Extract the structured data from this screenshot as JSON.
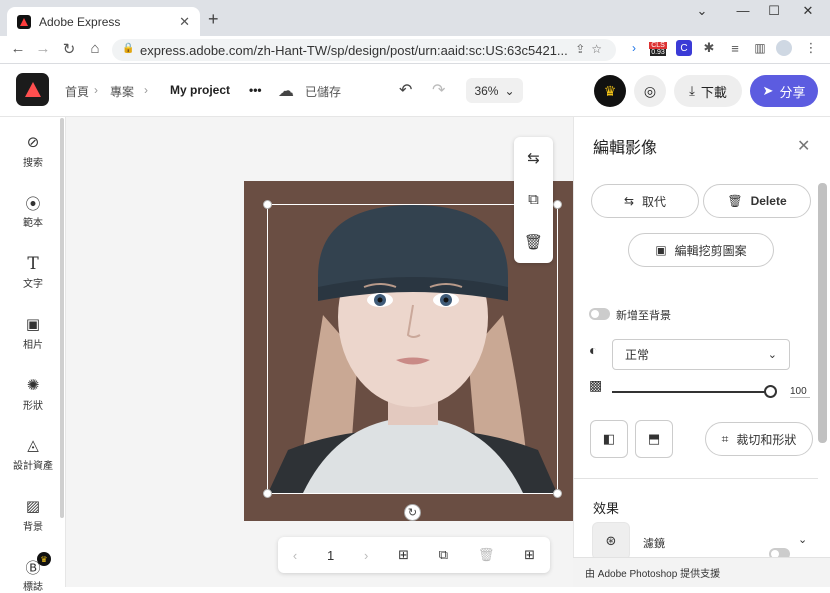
{
  "browser": {
    "tab_title": "Adobe Express",
    "tab_close": "✕",
    "new_tab": "+",
    "url": "express.adobe.com/zh-Hant-TW/sp/design/post/urn:aaid:sc:US:63c5421...",
    "window_min": "—",
    "window_max": "☐",
    "window_close": "✕",
    "ext_badge": "0.93"
  },
  "header": {
    "breadcrumb_home": "首頁",
    "breadcrumb_projects": "專案",
    "project_name": "My project",
    "more": "•••",
    "save_status": "已儲存",
    "zoom": "36%",
    "download_label": "下載",
    "share_label": "分享"
  },
  "sidebar": {
    "items": [
      {
        "label": "搜索",
        "icon": "search-icon"
      },
      {
        "label": "範本",
        "icon": "templates-icon"
      },
      {
        "label": "文字",
        "icon": "text-icon"
      },
      {
        "label": "相片",
        "icon": "photo-icon"
      },
      {
        "label": "形狀",
        "icon": "shapes-icon"
      },
      {
        "label": "設計資產",
        "icon": "design-assets-icon"
      },
      {
        "label": "背景",
        "icon": "background-icon"
      },
      {
        "label": "標誌",
        "icon": "brand-icon"
      }
    ]
  },
  "pager": {
    "page_number": "1"
  },
  "panel": {
    "title": "編輯影像",
    "replace_label": "取代",
    "delete_label": "Delete",
    "cutout_label": "編輯挖剪圖案",
    "add_to_background_label": "新增至背景",
    "blend_mode": "正常",
    "opacity_value": "100",
    "crop_label": "裁切和形狀",
    "effects_heading": "效果",
    "filters_label": "濾鏡",
    "footer_text": "由 Adobe Photoshop 提供支援"
  },
  "colors": {
    "accent": "#5c5ce0",
    "artboard_bg": "#6a4e43",
    "logo_red": "#ff4f4f"
  }
}
